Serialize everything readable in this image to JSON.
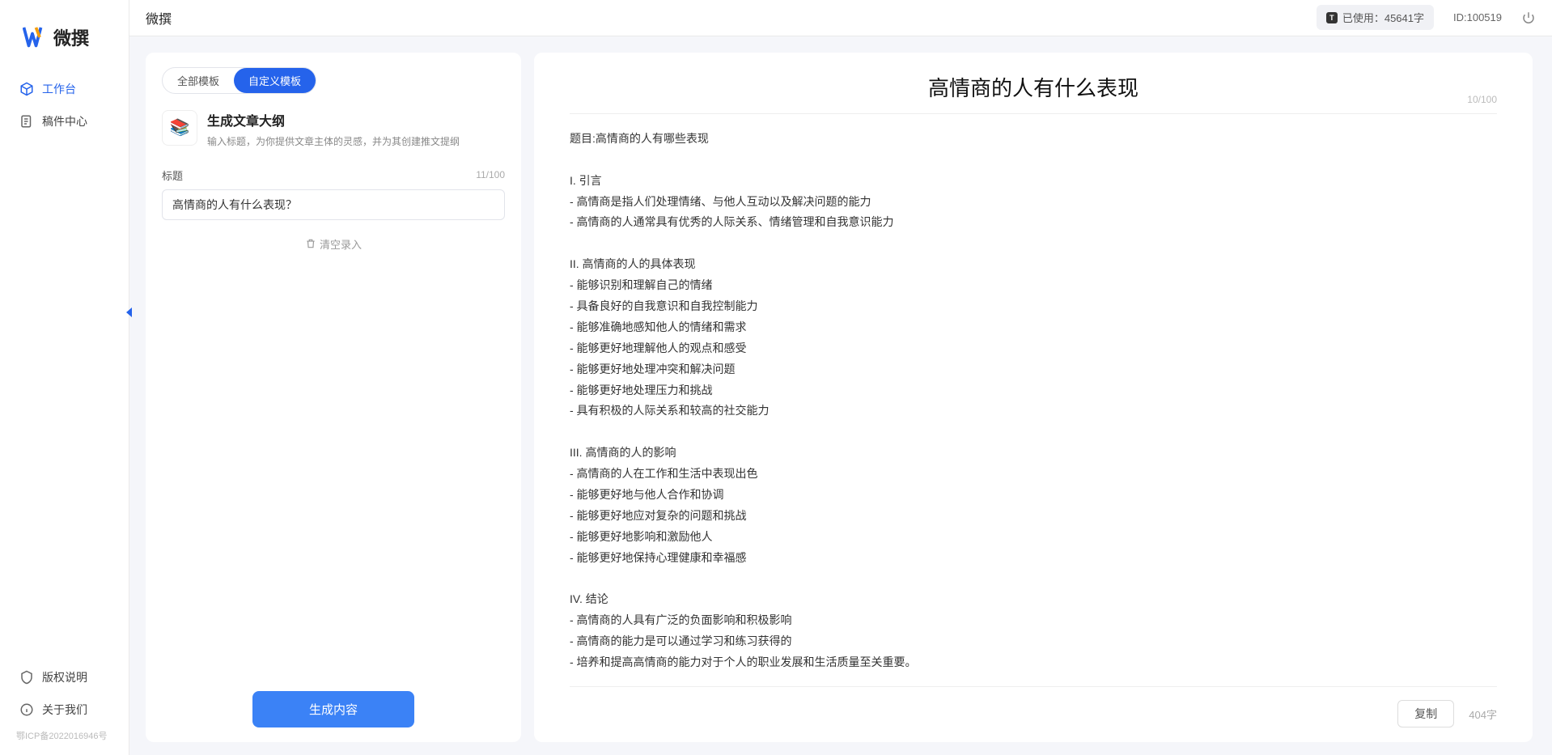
{
  "brand": {
    "name": "微撰"
  },
  "sidebar": {
    "items": [
      {
        "label": "工作台",
        "icon": "cube-icon",
        "active": true
      },
      {
        "label": "稿件中心",
        "icon": "document-icon",
        "active": false
      }
    ],
    "bottom": [
      {
        "label": "版权说明",
        "icon": "shield-icon"
      },
      {
        "label": "关于我们",
        "icon": "info-icon"
      }
    ],
    "icp": "鄂ICP备2022016946号"
  },
  "topbar": {
    "app_title": "微撰",
    "usage_label": "已使用：45641字",
    "user_id": "ID:100519"
  },
  "left_panel": {
    "tabs": [
      {
        "label": "全部模板",
        "active": false
      },
      {
        "label": "自定义模板",
        "active": true
      }
    ],
    "template": {
      "icon": "📚",
      "name": "生成文章大纲",
      "desc": "输入标题，为你提供文章主体的灵感，并为其创建推文提纲"
    },
    "title_field": {
      "label": "标题",
      "value": "高情商的人有什么表现？",
      "counter": "11/100"
    },
    "clear_label": "清空录入",
    "generate_label": "生成内容"
  },
  "right_panel": {
    "title": "高情商的人有什么表现",
    "title_counter": "10/100",
    "body": "题目:高情商的人有哪些表现\n\nI. 引言\n- 高情商是指人们处理情绪、与他人互动以及解决问题的能力\n- 高情商的人通常具有优秀的人际关系、情绪管理和自我意识能力\n\nII. 高情商的人的具体表现\n- 能够识别和理解自己的情绪\n- 具备良好的自我意识和自我控制能力\n- 能够准确地感知他人的情绪和需求\n- 能够更好地理解他人的观点和感受\n- 能够更好地处理冲突和解决问题\n- 能够更好地处理压力和挑战\n- 具有积极的人际关系和较高的社交能力\n\nIII. 高情商的人的影响\n- 高情商的人在工作和生活中表现出色\n- 能够更好地与他人合作和协调\n- 能够更好地应对复杂的问题和挑战\n- 能够更好地影响和激励他人\n- 能够更好地保持心理健康和幸福感\n\nIV. 结论\n- 高情商的人具有广泛的负面影响和积极影响\n- 高情商的能力是可以通过学习和练习获得的\n- 培养和提高高情商的能力对于个人的职业发展和生活质量至关重要。",
    "copy_label": "复制",
    "word_count": "404字"
  }
}
